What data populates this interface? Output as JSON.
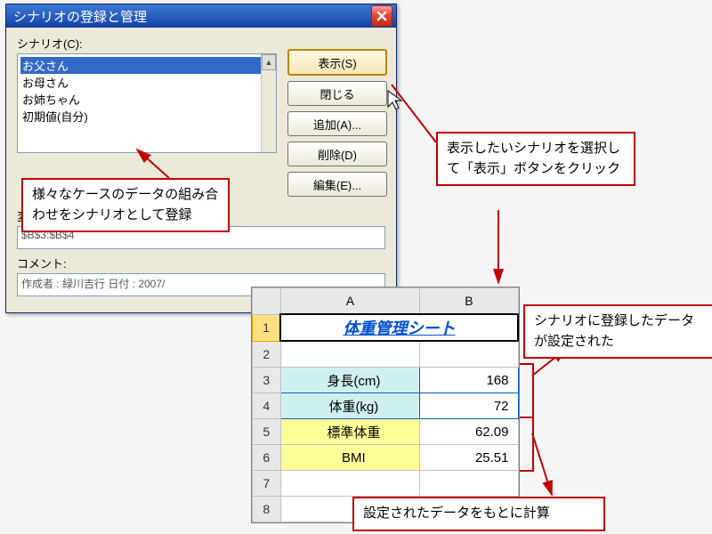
{
  "dialog": {
    "title": "シナリオの登録と管理",
    "scenario_label": "シナリオ(C):",
    "list": [
      "お父さん",
      "お母さん",
      "お姉ちゃん",
      "初期値(自分)"
    ],
    "buttons": {
      "show": "表示(S)",
      "close": "閉じる",
      "add": "追加(A)...",
      "delete": "削除(D)",
      "edit": "編集(E)..."
    },
    "changing_cells_label": "変化させるセル:",
    "changing_cells_value": "$B$3:$B$4",
    "comment_label": "コメント:",
    "comment_value": "作成者 : 緑川吉行 日付 : 2007/"
  },
  "callouts": {
    "c1": "様々なケースのデータの組み合わせをシナリオとして登録",
    "c2": "表示したいシナリオを選択して「表示」ボタンをクリック",
    "c3": "シナリオに登録したデータが設定された",
    "c4": "設定されたデータをもとに計算"
  },
  "sheet": {
    "cols": [
      "A",
      "B"
    ],
    "title_cell": "体重管理シート",
    "rows": [
      {
        "n": "1"
      },
      {
        "n": "2"
      },
      {
        "n": "3",
        "a": "身長(cm)",
        "b": "168"
      },
      {
        "n": "4",
        "a": "体重(kg)",
        "b": "72"
      },
      {
        "n": "5",
        "a": "標準体重",
        "b": "62.09"
      },
      {
        "n": "6",
        "a": "BMI",
        "b": "25.51"
      },
      {
        "n": "7"
      },
      {
        "n": "8"
      }
    ]
  },
  "chart_data": {
    "type": "table",
    "title": "体重管理シート",
    "rows": [
      {
        "label": "身長(cm)",
        "value": 168
      },
      {
        "label": "体重(kg)",
        "value": 72
      },
      {
        "label": "標準体重",
        "value": 62.09
      },
      {
        "label": "BMI",
        "value": 25.51
      }
    ]
  }
}
